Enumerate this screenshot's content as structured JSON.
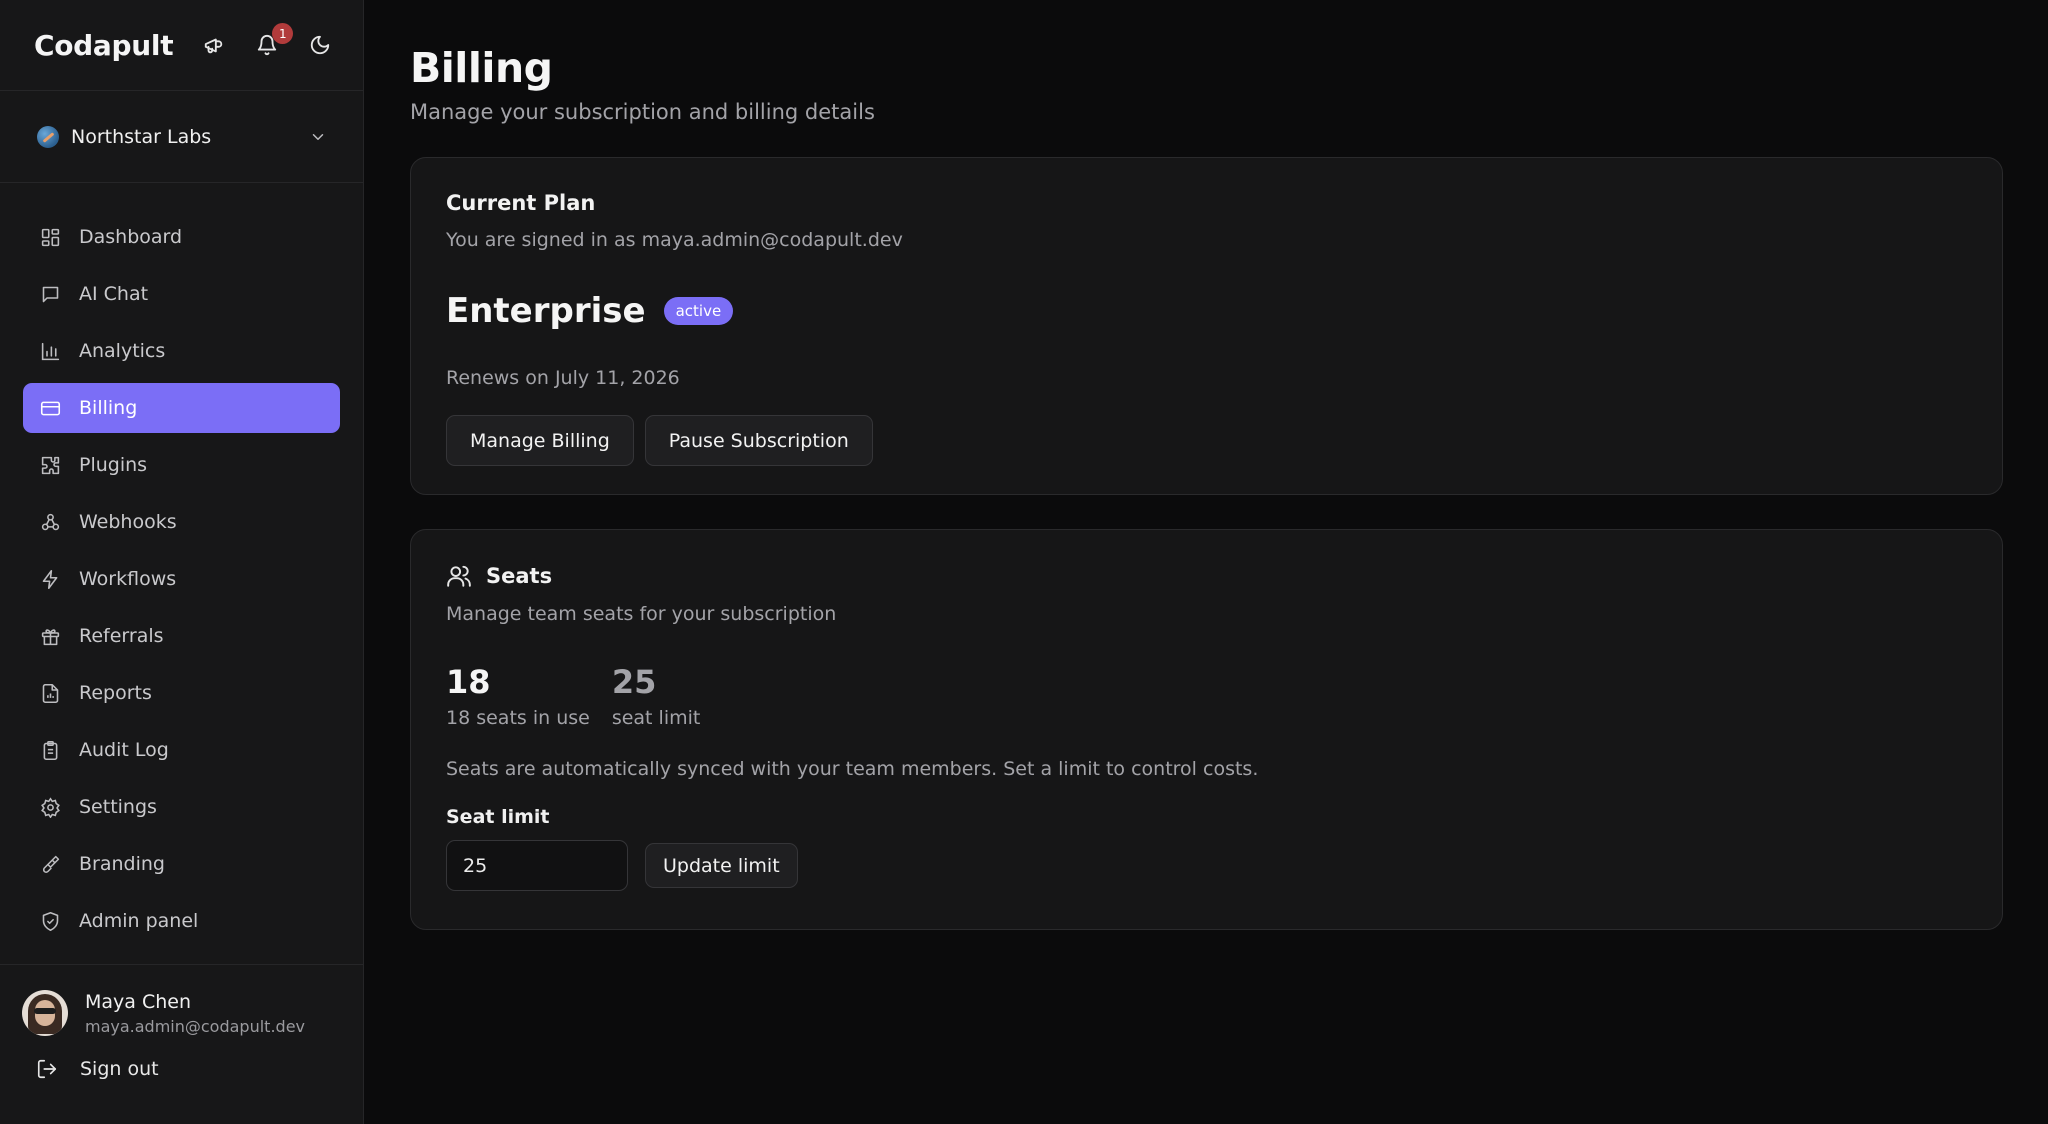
{
  "app": {
    "brand": "Codapult",
    "notifications_count": "1"
  },
  "org": {
    "name": "Northstar Labs"
  },
  "sidebar": {
    "items": [
      {
        "label": "Dashboard",
        "icon": "dashboard-icon"
      },
      {
        "label": "AI Chat",
        "icon": "chat-icon"
      },
      {
        "label": "Analytics",
        "icon": "analytics-icon"
      },
      {
        "label": "Billing",
        "icon": "billing-icon",
        "active": true
      },
      {
        "label": "Plugins",
        "icon": "puzzle-icon"
      },
      {
        "label": "Webhooks",
        "icon": "webhook-icon"
      },
      {
        "label": "Workflows",
        "icon": "zap-icon"
      },
      {
        "label": "Referrals",
        "icon": "gift-icon"
      },
      {
        "label": "Reports",
        "icon": "report-icon"
      },
      {
        "label": "Audit Log",
        "icon": "clipboard-icon"
      },
      {
        "label": "Settings",
        "icon": "gear-icon"
      },
      {
        "label": "Branding",
        "icon": "brush-icon"
      },
      {
        "label": "Admin panel",
        "icon": "shield-icon"
      }
    ]
  },
  "user": {
    "name": "Maya Chen",
    "email": "maya.admin@codapult.dev",
    "sign_out": "Sign out"
  },
  "page": {
    "title": "Billing",
    "subtitle": "Manage your subscription and billing details"
  },
  "plan": {
    "card_title": "Current Plan",
    "signed_in": "You are signed in as maya.admin@codapult.dev",
    "name": "Enterprise",
    "status": "active",
    "renews": "Renews on July 11, 2026",
    "manage_button": "Manage Billing",
    "pause_button": "Pause Subscription"
  },
  "seats": {
    "card_title": "Seats",
    "description": "Manage team seats for your subscription",
    "in_use_value": "18",
    "in_use_label": "18 seats in use",
    "limit_value": "25",
    "limit_label": "seat limit",
    "note": "Seats are automatically synced with your team members. Set a limit to control costs.",
    "input_label": "Seat limit",
    "input_value": "25",
    "update_button": "Update limit"
  },
  "colors": {
    "accent": "#7b6ef6",
    "badge": "#b13b3b",
    "background": "#0b0b0c",
    "sidebar": "#171718",
    "card": "#161617"
  }
}
